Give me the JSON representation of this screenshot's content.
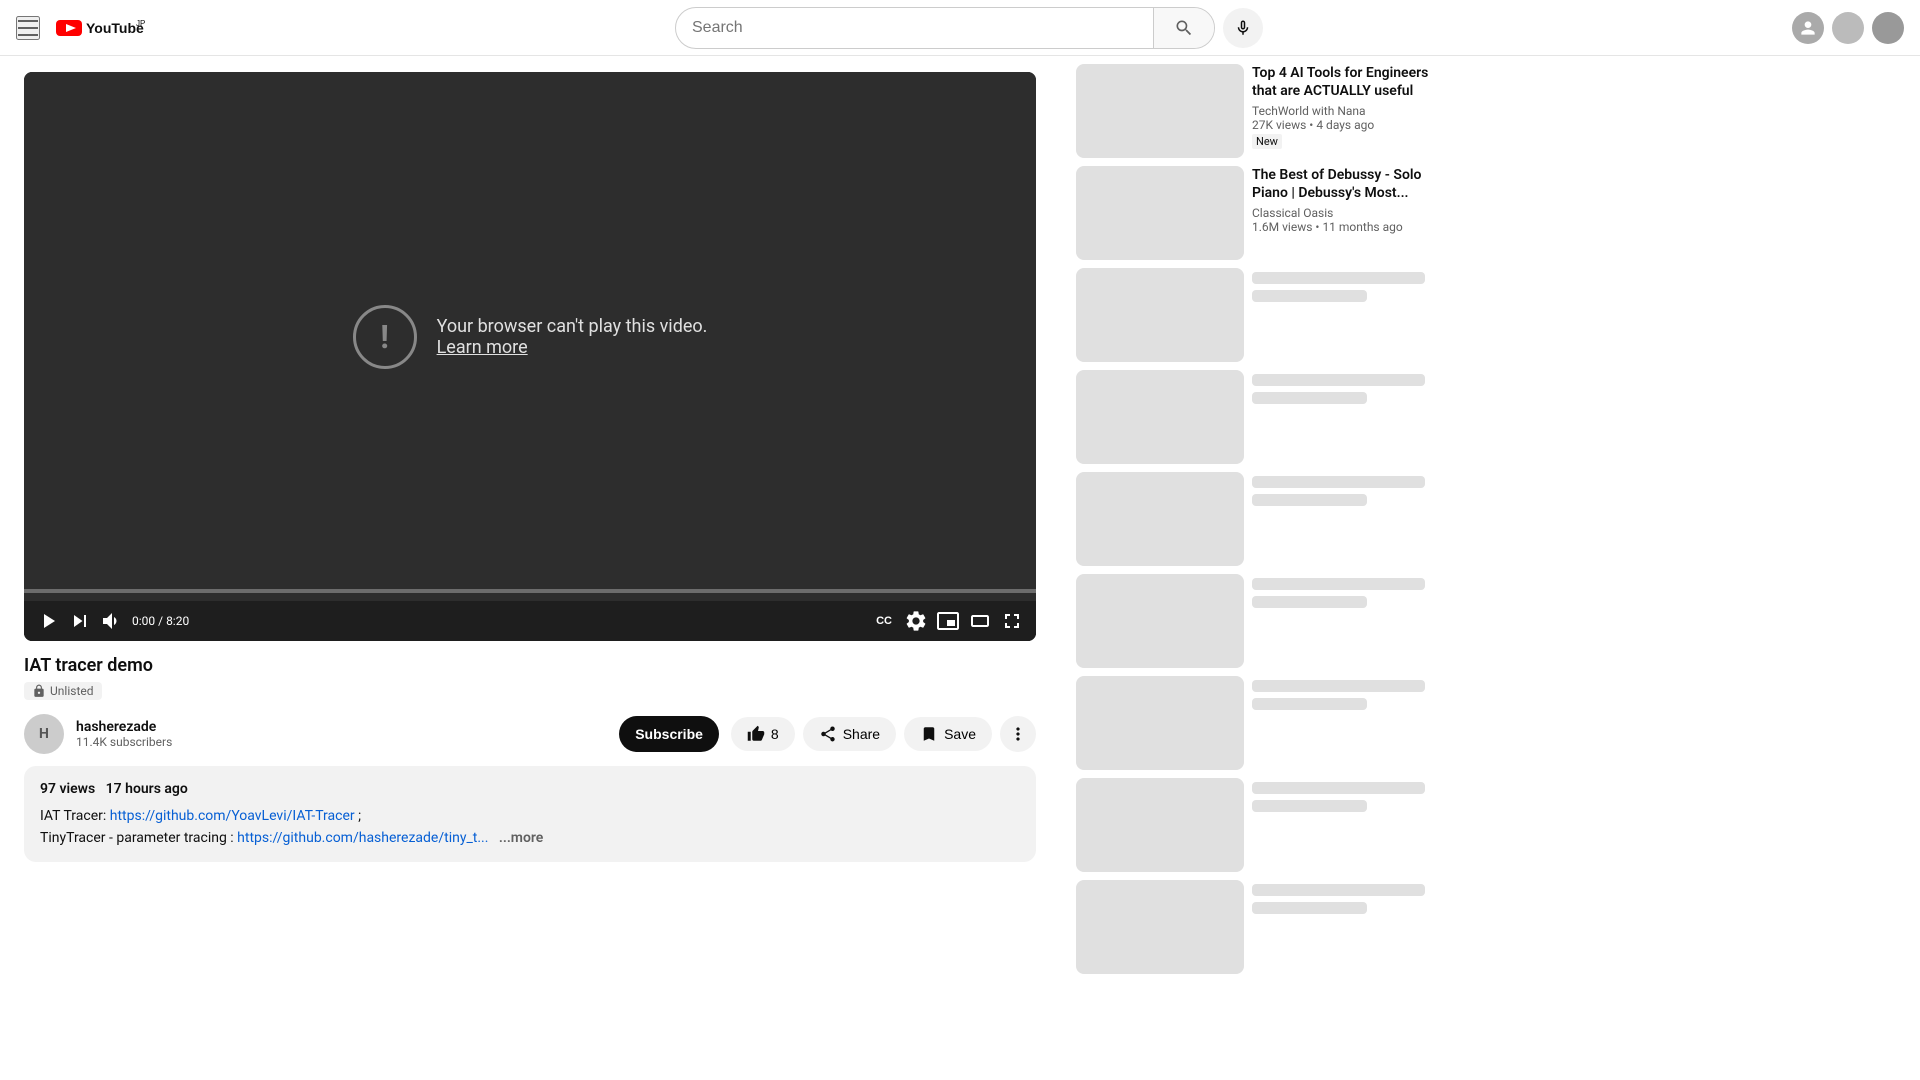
{
  "header": {
    "menu_label": "Menu",
    "logo_text": "YouTube",
    "logo_country": "JP",
    "search_placeholder": "Search",
    "search_button_label": "Search",
    "mic_label": "Search with your voice",
    "avatar_label": "User account"
  },
  "video": {
    "error_message": "Your browser can't play this video.",
    "learn_more_label": "Learn more",
    "time_current": "0:00",
    "time_total": "8:20",
    "title": "IAT tracer demo",
    "unlisted_badge": "Unlisted"
  },
  "channel": {
    "name": "hasherezade",
    "subscribers": "11.4K subscribers",
    "subscribe_label": "Subscribe"
  },
  "actions": {
    "like_count": "8",
    "share_label": "Share",
    "save_label": "Save"
  },
  "description": {
    "views": "97 views",
    "time_ago": "17 hours ago",
    "text_before_link1": "IAT Tracer: ",
    "link1_text": "https://github.com/YoavLevi/IAT-Tracer",
    "link1_url": "https://github.com/YoavLevi/IAT-Tracer",
    "text_between": " ;",
    "text_before_link2": "TinyTracer - parameter tracing : ",
    "link2_text": "https://github.com/hasherezade/tiny_t...",
    "link2_url": "#",
    "more_label": "...more"
  },
  "sidebar": {
    "video1": {
      "title": "Top 4 AI Tools for Engineers that are ACTUALLY useful",
      "channel": "TechWorld with Nana",
      "views": "27K views",
      "time_ago": "4 days ago",
      "badge": "New"
    },
    "video2": {
      "title": "The Best of Debussy - Solo Piano | Debussy's Most...",
      "channel": "Classical Oasis",
      "views": "1.6M views",
      "time_ago": "11 months ago"
    }
  },
  "icons": {
    "hamburger": "☰",
    "search": "🔍",
    "mic": "🎤",
    "play": "▶",
    "skip_next": "⏭",
    "volume": "🔊",
    "subtitles": "CC",
    "settings": "⚙",
    "mini_player": "⊡",
    "theater": "⬜",
    "fullscreen": "⛶",
    "like": "👍",
    "dots": "•••",
    "lock": "🔒"
  }
}
